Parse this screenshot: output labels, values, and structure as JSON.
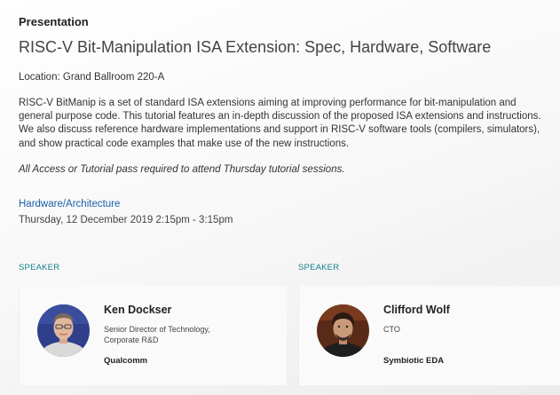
{
  "session": {
    "kind": "Presentation",
    "title": "RISC-V Bit-Manipulation ISA Extension: Spec, Hardware, Software",
    "location": "Location: Grand Ballroom 220-A",
    "description": "RISC-V BitManip is a set of standard ISA extensions aiming at improving performance for bit-manipulation and general purpose code. This tutorial features an in-depth discussion of the proposed ISA extensions and instructions. We also discuss reference hardware implementations and support in RISC-V software tools (compilers, simulators), and show practical code examples that make use of the new instructions.",
    "note": "All Access or Tutorial pass required to attend Thursday tutorial sessions.",
    "track": "Hardware/Architecture",
    "datetime": "Thursday, 12 December 2019 2:15pm - 3:15pm"
  },
  "speakers": [
    {
      "label": "SPEAKER",
      "name": "Ken Dockser",
      "role": "Senior Director of Technology, Corporate R&D",
      "org": "Qualcomm",
      "photo_icon": "person-photo"
    },
    {
      "label": "SPEAKER",
      "name": "Clifford Wolf",
      "role": "CTO",
      "org": "Symbiotic EDA",
      "photo_icon": "person-photo"
    }
  ],
  "colors": {
    "link": "#1a5fa8",
    "speaker_label": "#16818a"
  }
}
